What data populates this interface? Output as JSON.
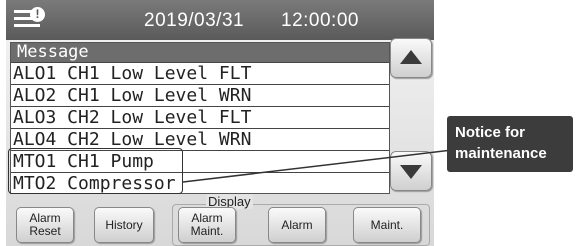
{
  "top_bar": {
    "date": "2019/03/31",
    "time": "12:00:00",
    "alert_badge": "!"
  },
  "message_list": {
    "header": "Message",
    "rows": [
      "ALO1 CH1 Low Level FLT",
      "ALO2 CH1 Low Level WRN",
      "ALO3 CH2 Low Level FLT",
      "ALO4 CH2 Low Level WRN",
      "MTO1 CH1 Pump",
      "MTO2 Compressor"
    ]
  },
  "buttons": {
    "alarm_reset": "Alarm\nReset",
    "history": "History",
    "alarm_maint": "Alarm\nMaint.",
    "alarm": "Alarm",
    "maint": "Maint."
  },
  "display_group_label": "Display",
  "callout": "Notice for\nmaintenance",
  "icons": {
    "menu": "menu-icon",
    "scroll_up": "triangle-up-icon",
    "scroll_down": "triangle-down-icon"
  }
}
